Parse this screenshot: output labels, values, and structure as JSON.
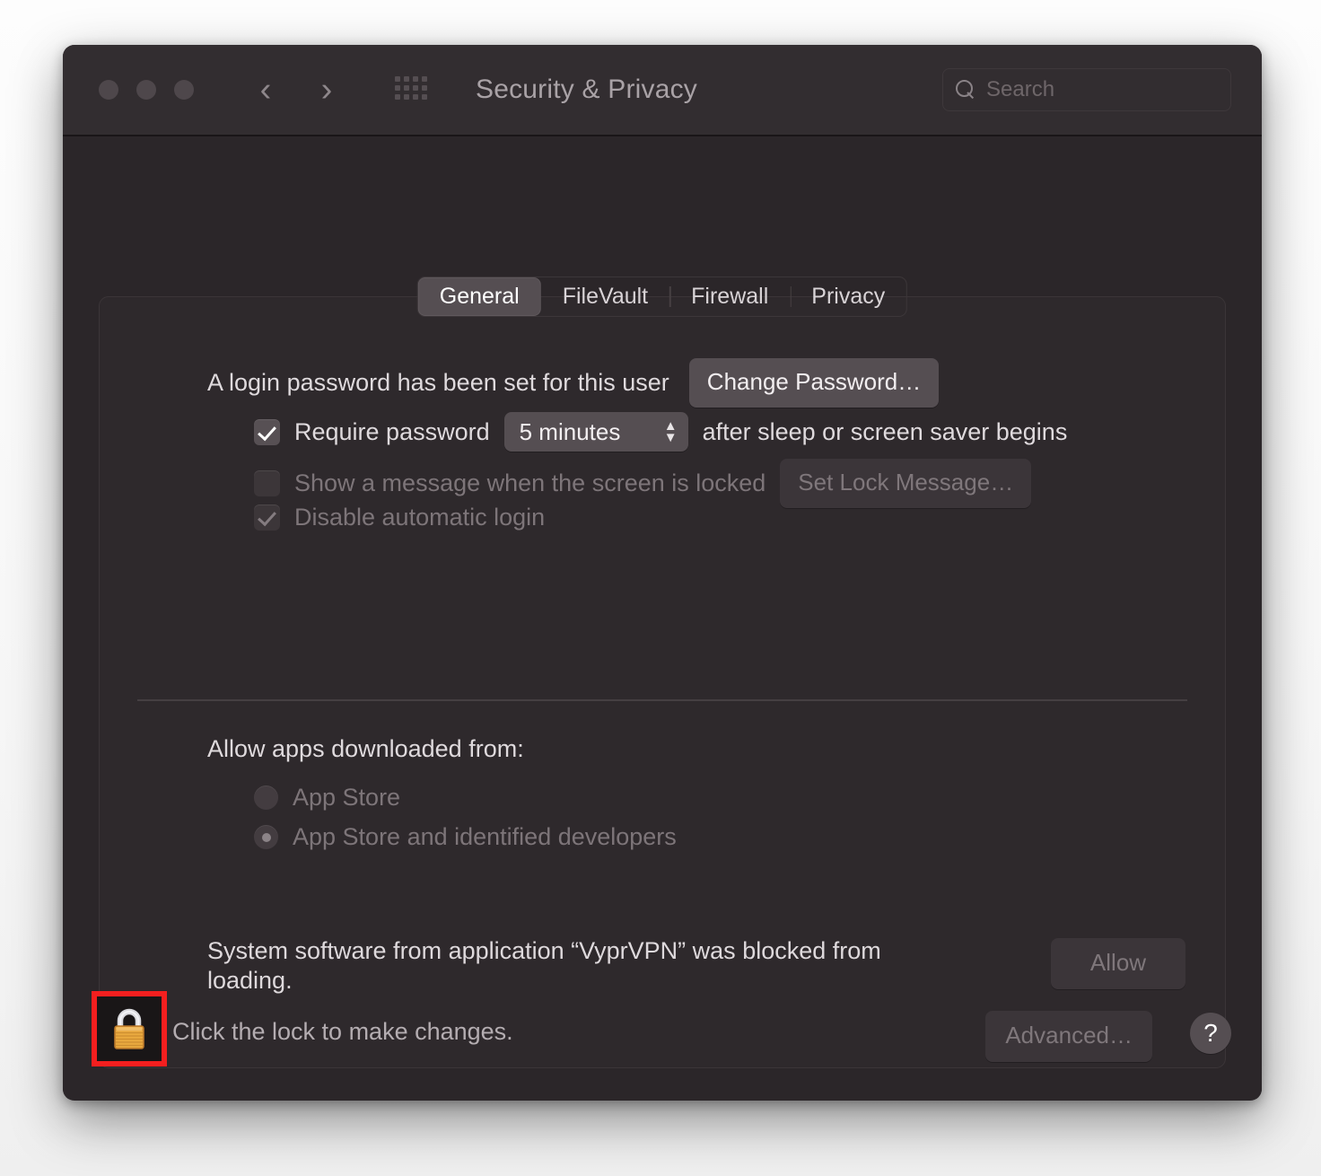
{
  "window": {
    "title": "Security & Privacy",
    "traffic_lights": [
      "close",
      "minimize",
      "zoom"
    ],
    "nav_back_icon": "chevron-left-icon",
    "nav_forward_icon": "chevron-right-icon",
    "grid_icon": "show-all-grid-icon",
    "colors": {
      "window_bg": "#2b2629",
      "titlebar_bg": "#322d30",
      "panel_bg": "#2e292c",
      "control_bg": "#554e52",
      "text_primary": "#dfdadd",
      "text_dim": "#7d7579",
      "highlight_red": "#f41f1f",
      "lock_gold": "#e8a33c"
    }
  },
  "search": {
    "icon": "search-icon",
    "placeholder": "Search",
    "value": ""
  },
  "tabs": [
    {
      "label": "General",
      "active": true
    },
    {
      "label": "FileVault",
      "active": false
    },
    {
      "label": "Firewall",
      "active": false
    },
    {
      "label": "Privacy",
      "active": false
    }
  ],
  "general": {
    "login_password_text": "A login password has been set for this user",
    "change_password_button": "Change Password…",
    "require_password": {
      "checked": true,
      "label": "Require password",
      "delay_value": "5 minutes",
      "suffix": "after sleep or screen saver begins",
      "stepper_icon": "chevron-up-down-icon"
    },
    "show_message": {
      "checked": false,
      "enabled": false,
      "label": "Show a message when the screen is locked",
      "button": "Set Lock Message…"
    },
    "disable_automatic_login": {
      "checked": true,
      "enabled": false,
      "label": "Disable automatic login"
    },
    "allow_apps": {
      "title": "Allow apps downloaded from:",
      "options": [
        {
          "label": "App Store",
          "selected": false
        },
        {
          "label": "App Store and identified developers",
          "selected": true
        }
      ]
    },
    "blocked_software": {
      "message": "System software from application “VyprVPN” was blocked from loading.",
      "allow_button": "Allow",
      "allow_enabled": false
    }
  },
  "footer": {
    "lock_icon": "lock-closed-icon",
    "lock_highlighted": true,
    "lock_text": "Click the lock to make changes.",
    "advanced_button": "Advanced…",
    "help_button": "?",
    "help_icon": "question-mark-icon"
  }
}
